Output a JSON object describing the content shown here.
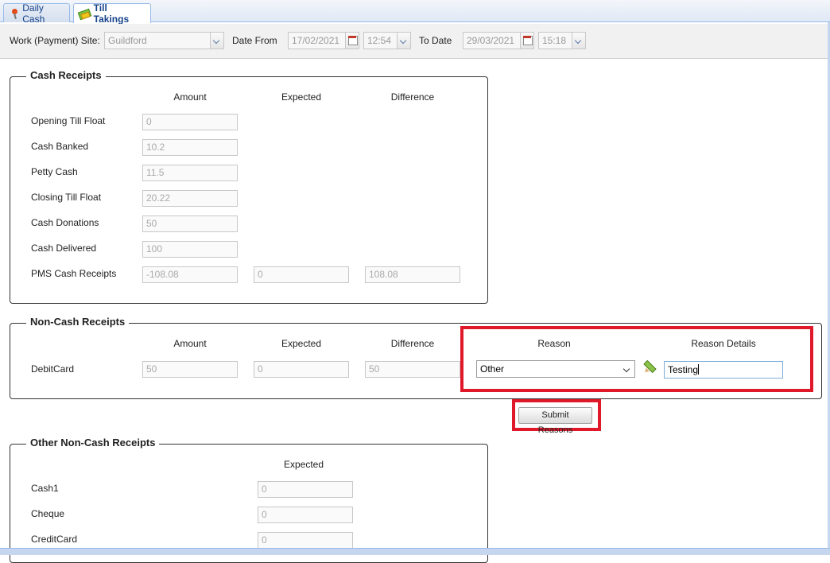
{
  "tabs": [
    {
      "label": "Daily Cash",
      "icon": "pin-icon"
    },
    {
      "label": "Till Takings",
      "icon": "money-icon",
      "active": true
    }
  ],
  "toolbar": {
    "site_label": "Work (Payment) Site:",
    "site_value": "Guildford",
    "date_from_label": "Date From",
    "date_from": "17/02/2021",
    "time_from": "12:54",
    "to_date_label": "To Date",
    "date_to": "29/03/2021",
    "time_to": "15:18"
  },
  "cash_receipts": {
    "title": "Cash Receipts",
    "headers": {
      "amount": "Amount",
      "expected": "Expected",
      "difference": "Difference"
    },
    "rows": [
      {
        "label": "Opening Till Float",
        "amount": "0"
      },
      {
        "label": "Cash Banked",
        "amount": "10.2"
      },
      {
        "label": "Petty Cash",
        "amount": "11.5"
      },
      {
        "label": "Closing Till Float",
        "amount": "20.22"
      },
      {
        "label": "Cash Donations",
        "amount": "50"
      },
      {
        "label": "Cash Delivered",
        "amount": "100"
      },
      {
        "label": "PMS Cash Receipts",
        "amount": "-108.08",
        "expected": "0",
        "difference": "108.08"
      }
    ]
  },
  "non_cash_receipts": {
    "title": "Non-Cash Receipts",
    "headers": {
      "amount": "Amount",
      "expected": "Expected",
      "difference": "Difference",
      "reason": "Reason",
      "reason_details": "Reason Details"
    },
    "rows": [
      {
        "label": "DebitCard",
        "amount": "50",
        "expected": "0",
        "difference": "50",
        "reason": "Other",
        "reason_details": "Testing"
      }
    ],
    "submit_label": "Submit Reasons"
  },
  "other_non_cash": {
    "title": "Other Non-Cash Receipts",
    "headers": {
      "expected": "Expected"
    },
    "rows": [
      {
        "label": "Cash1",
        "expected": "0"
      },
      {
        "label": "Cheque",
        "expected": "0"
      },
      {
        "label": "CreditCard",
        "expected": "0"
      }
    ]
  },
  "highlight_color": "#e0192a"
}
